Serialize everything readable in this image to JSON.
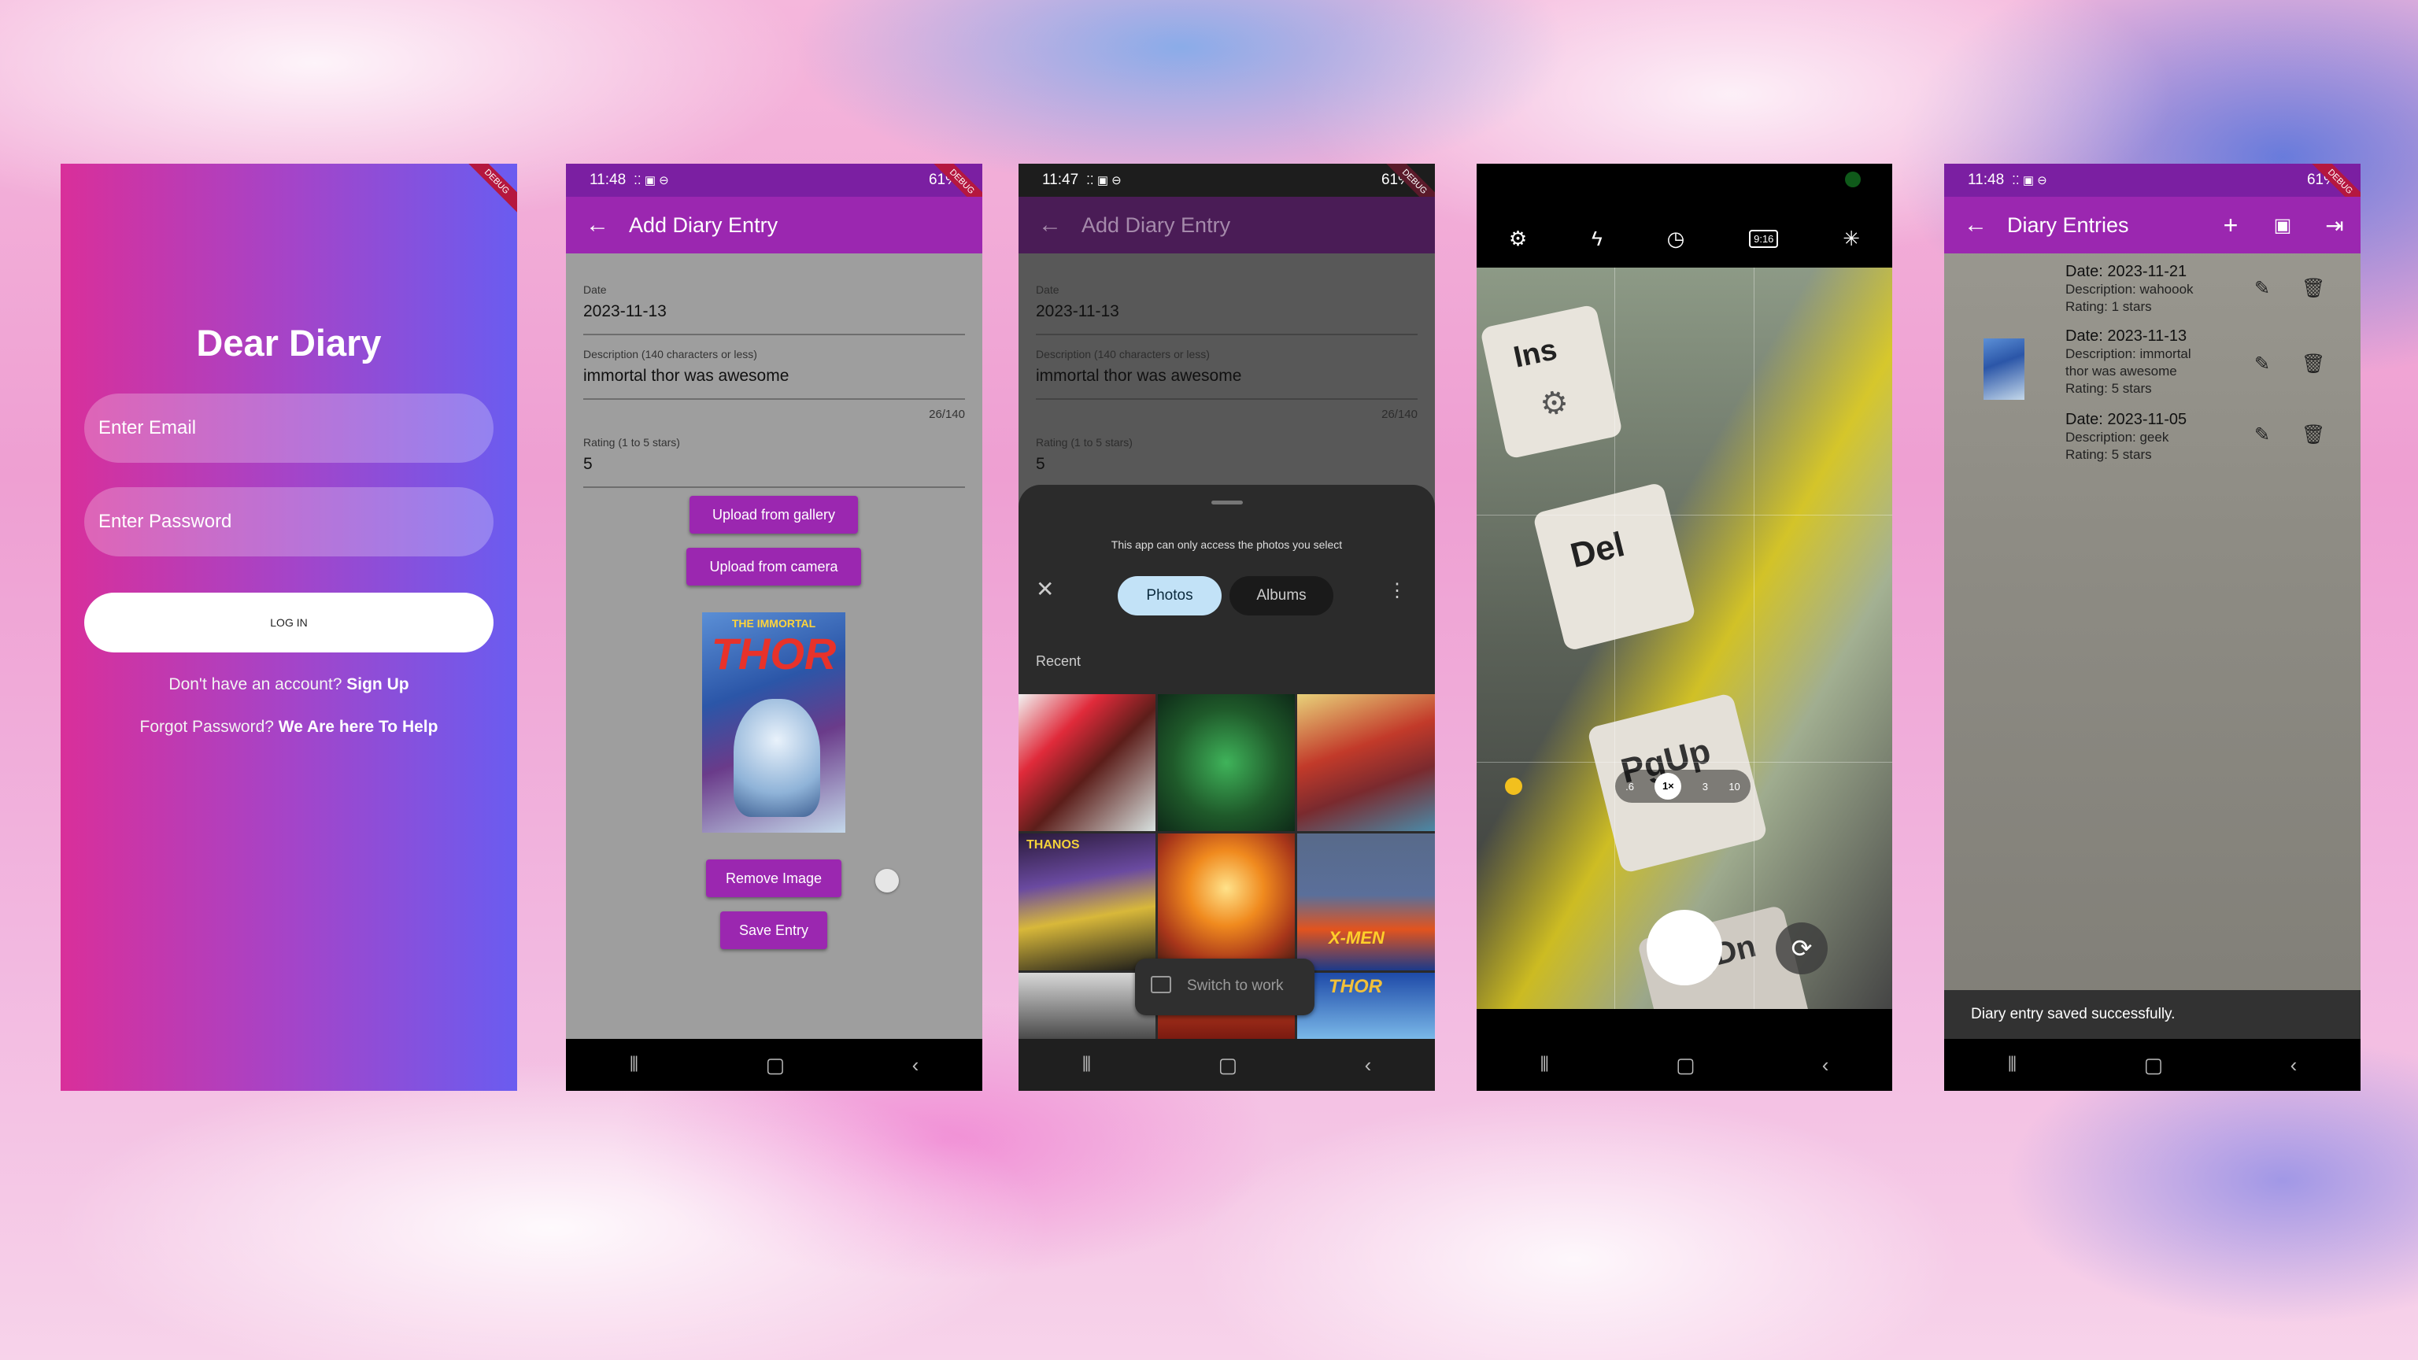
{
  "login": {
    "title": "Dear Diary",
    "email_placeholder": "Enter Email",
    "password_placeholder": "Enter Password",
    "login_button": "LOG IN",
    "no_account_text": "Don't have an account?",
    "signup_link": "Sign Up",
    "forgot_text": "Forgot Password?",
    "help_link": "We Are here To Help",
    "debug": "DEBUG"
  },
  "add_entry": {
    "status_time": "11:48",
    "status_right": "61%",
    "title": "Add Diary Entry",
    "date_label": "Date",
    "date_value": "2023-11-13",
    "desc_label": "Description (140 characters or less)",
    "desc_value": "immortal thor was awesome",
    "char_count": "26/140",
    "rating_label": "Rating (1 to 5 stars)",
    "rating_value": "5",
    "upload_gallery": "Upload from gallery",
    "upload_camera": "Upload from camera",
    "remove_image": "Remove Image",
    "save_entry": "Save Entry",
    "comic_title": "THOR",
    "comic_banner": "THE IMMORTAL",
    "debug": "DEBUG"
  },
  "picker": {
    "status_time": "11:47",
    "status_right": "61%",
    "title": "Add Diary Entry",
    "date_label": "Date",
    "date_value": "2023-11-13",
    "desc_label": "Description (140 characters or less)",
    "desc_value": "immortal thor was awesome",
    "char_count": "26/140",
    "rating_label": "Rating (1 to 5 stars)",
    "rating_value": "5",
    "sheet_notice": "This app can only access the photos you select",
    "tab_photos": "Photos",
    "tab_albums": "Albums",
    "recent_label": "Recent",
    "switch_to_work": "Switch to work",
    "thumb_text_1": "THANOS",
    "thumb_text_2": "X-MEN",
    "thumb_text_3": "THOR",
    "debug": "DEBUG"
  },
  "camera": {
    "zoom_options": [
      ".6",
      "1×",
      "3",
      "10"
    ],
    "key_labels": [
      "Ins",
      "Del",
      "PgUp",
      "PgDn"
    ],
    "aspect_label": "9:16"
  },
  "entries": {
    "status_time": "11:48",
    "status_right": "61%",
    "title": "Diary Entries",
    "items": [
      {
        "date": "Date: 2023-11-21",
        "desc": "Description: wahoook",
        "rating": "Rating: 1 stars"
      },
      {
        "date": "Date: 2023-11-13",
        "desc": "Description: immortal",
        "desc2": "thor was awesome",
        "rating": "Rating: 5 stars"
      },
      {
        "date": "Date: 2023-11-05",
        "desc": "Description: geek",
        "rating": "Rating: 5 stars"
      }
    ],
    "snackbar": "Diary entry saved successfully.",
    "debug": "DEBUG"
  },
  "colors": {
    "purple": "#9b27b0",
    "login_gradient_start": "#d92f9a",
    "login_gradient_end": "#6a5cf0"
  }
}
